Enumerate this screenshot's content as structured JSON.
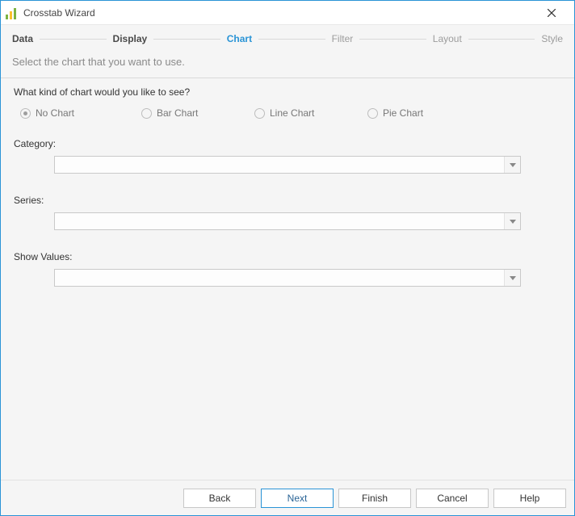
{
  "window": {
    "title": "Crosstab Wizard"
  },
  "steps": [
    {
      "label": "Data",
      "state": "done"
    },
    {
      "label": "Display",
      "state": "done"
    },
    {
      "label": "Chart",
      "state": "active"
    },
    {
      "label": "Filter",
      "state": "future"
    },
    {
      "label": "Layout",
      "state": "future"
    },
    {
      "label": "Style",
      "state": "future"
    }
  ],
  "subtitle": "Select the chart that you want to use.",
  "question": "What kind of chart would you like to see?",
  "chart_options": [
    {
      "label": "No Chart",
      "selected": true
    },
    {
      "label": "Bar Chart",
      "selected": false
    },
    {
      "label": "Line Chart",
      "selected": false
    },
    {
      "label": "Pie Chart",
      "selected": false
    }
  ],
  "fields": {
    "category": {
      "label": "Category:",
      "value": ""
    },
    "series": {
      "label": "Series:",
      "value": ""
    },
    "show_values": {
      "label": "Show Values:",
      "value": ""
    }
  },
  "buttons": {
    "back": "Back",
    "next": "Next",
    "finish": "Finish",
    "cancel": "Cancel",
    "help": "Help"
  }
}
